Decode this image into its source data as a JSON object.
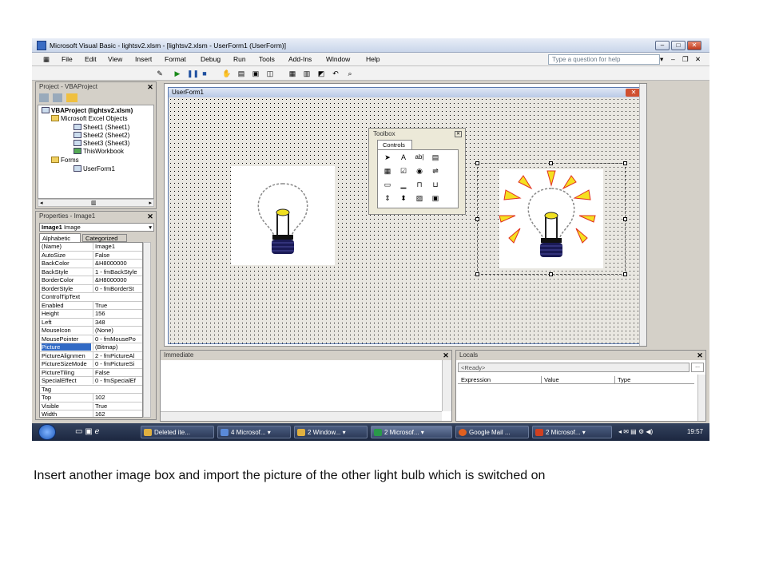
{
  "window": {
    "title": "Microsoft Visual Basic - lightsv2.xlsm - [lightsv2.xlsm - UserForm1 (UserForm)]"
  },
  "menu": {
    "items": [
      "File",
      "Edit",
      "View",
      "Insert",
      "Format",
      "Debug",
      "Run",
      "Tools",
      "Add-Ins",
      "Window",
      "Help"
    ],
    "ask_placeholder": "Type a question for help"
  },
  "project": {
    "title": "Project - VBAProject",
    "root": "VBAProject (lightsv2.xlsm)",
    "excel_folder": "Microsoft Excel Objects",
    "sheets": [
      "Sheet1 (Sheet1)",
      "Sheet2 (Sheet2)",
      "Sheet3 (Sheet3)",
      "ThisWorkbook"
    ],
    "forms_folder": "Forms",
    "userform": "UserForm1"
  },
  "properties": {
    "title": "Properties - Image1",
    "object": "Image1",
    "object_type": "Image",
    "tabs": [
      "Alphabetic",
      "Categorized"
    ],
    "rows": [
      [
        "(Name)",
        "Image1"
      ],
      [
        "AutoSize",
        "False"
      ],
      [
        "BackColor",
        "&H8000000"
      ],
      [
        "BackStyle",
        "1 - fmBackStyle"
      ],
      [
        "BorderColor",
        "&H8000000"
      ],
      [
        "BorderStyle",
        "0 - fmBorderSt"
      ],
      [
        "ControlTipText",
        ""
      ],
      [
        "Enabled",
        "True"
      ],
      [
        "Height",
        "156"
      ],
      [
        "Left",
        "348"
      ],
      [
        "MouseIcon",
        "(None)"
      ],
      [
        "MousePointer",
        "0 - fmMousePo"
      ],
      [
        "Picture",
        "(Bitmap)"
      ],
      [
        "PictureAlignmen",
        "2 - fmPictureAl"
      ],
      [
        "PictureSizeMode",
        "0 - fmPictureSi"
      ],
      [
        "PictureTiling",
        "False"
      ],
      [
        "SpecialEffect",
        "0 - fmSpecialEf"
      ],
      [
        "Tag",
        ""
      ],
      [
        "Top",
        "102"
      ],
      [
        "Visible",
        "True"
      ],
      [
        "Width",
        "162"
      ]
    ],
    "selected_row": "Picture"
  },
  "form": {
    "title": "UserForm1"
  },
  "toolbox": {
    "title": "Toolbox",
    "tab": "Controls"
  },
  "immediate": {
    "title": "Immediate"
  },
  "locals": {
    "title": "Locals",
    "status": "<Ready>",
    "columns": [
      "Expression",
      "Value",
      "Type"
    ]
  },
  "taskbar": {
    "tasks": [
      "Deleted ite...",
      "4 Microsof...",
      "2 Window...",
      "2 Microsof...",
      "Google Mail ...",
      "2 Microsof..."
    ],
    "time": "19:57"
  },
  "caption": "Insert another image box and import the picture of the other light bulb which is switched on"
}
